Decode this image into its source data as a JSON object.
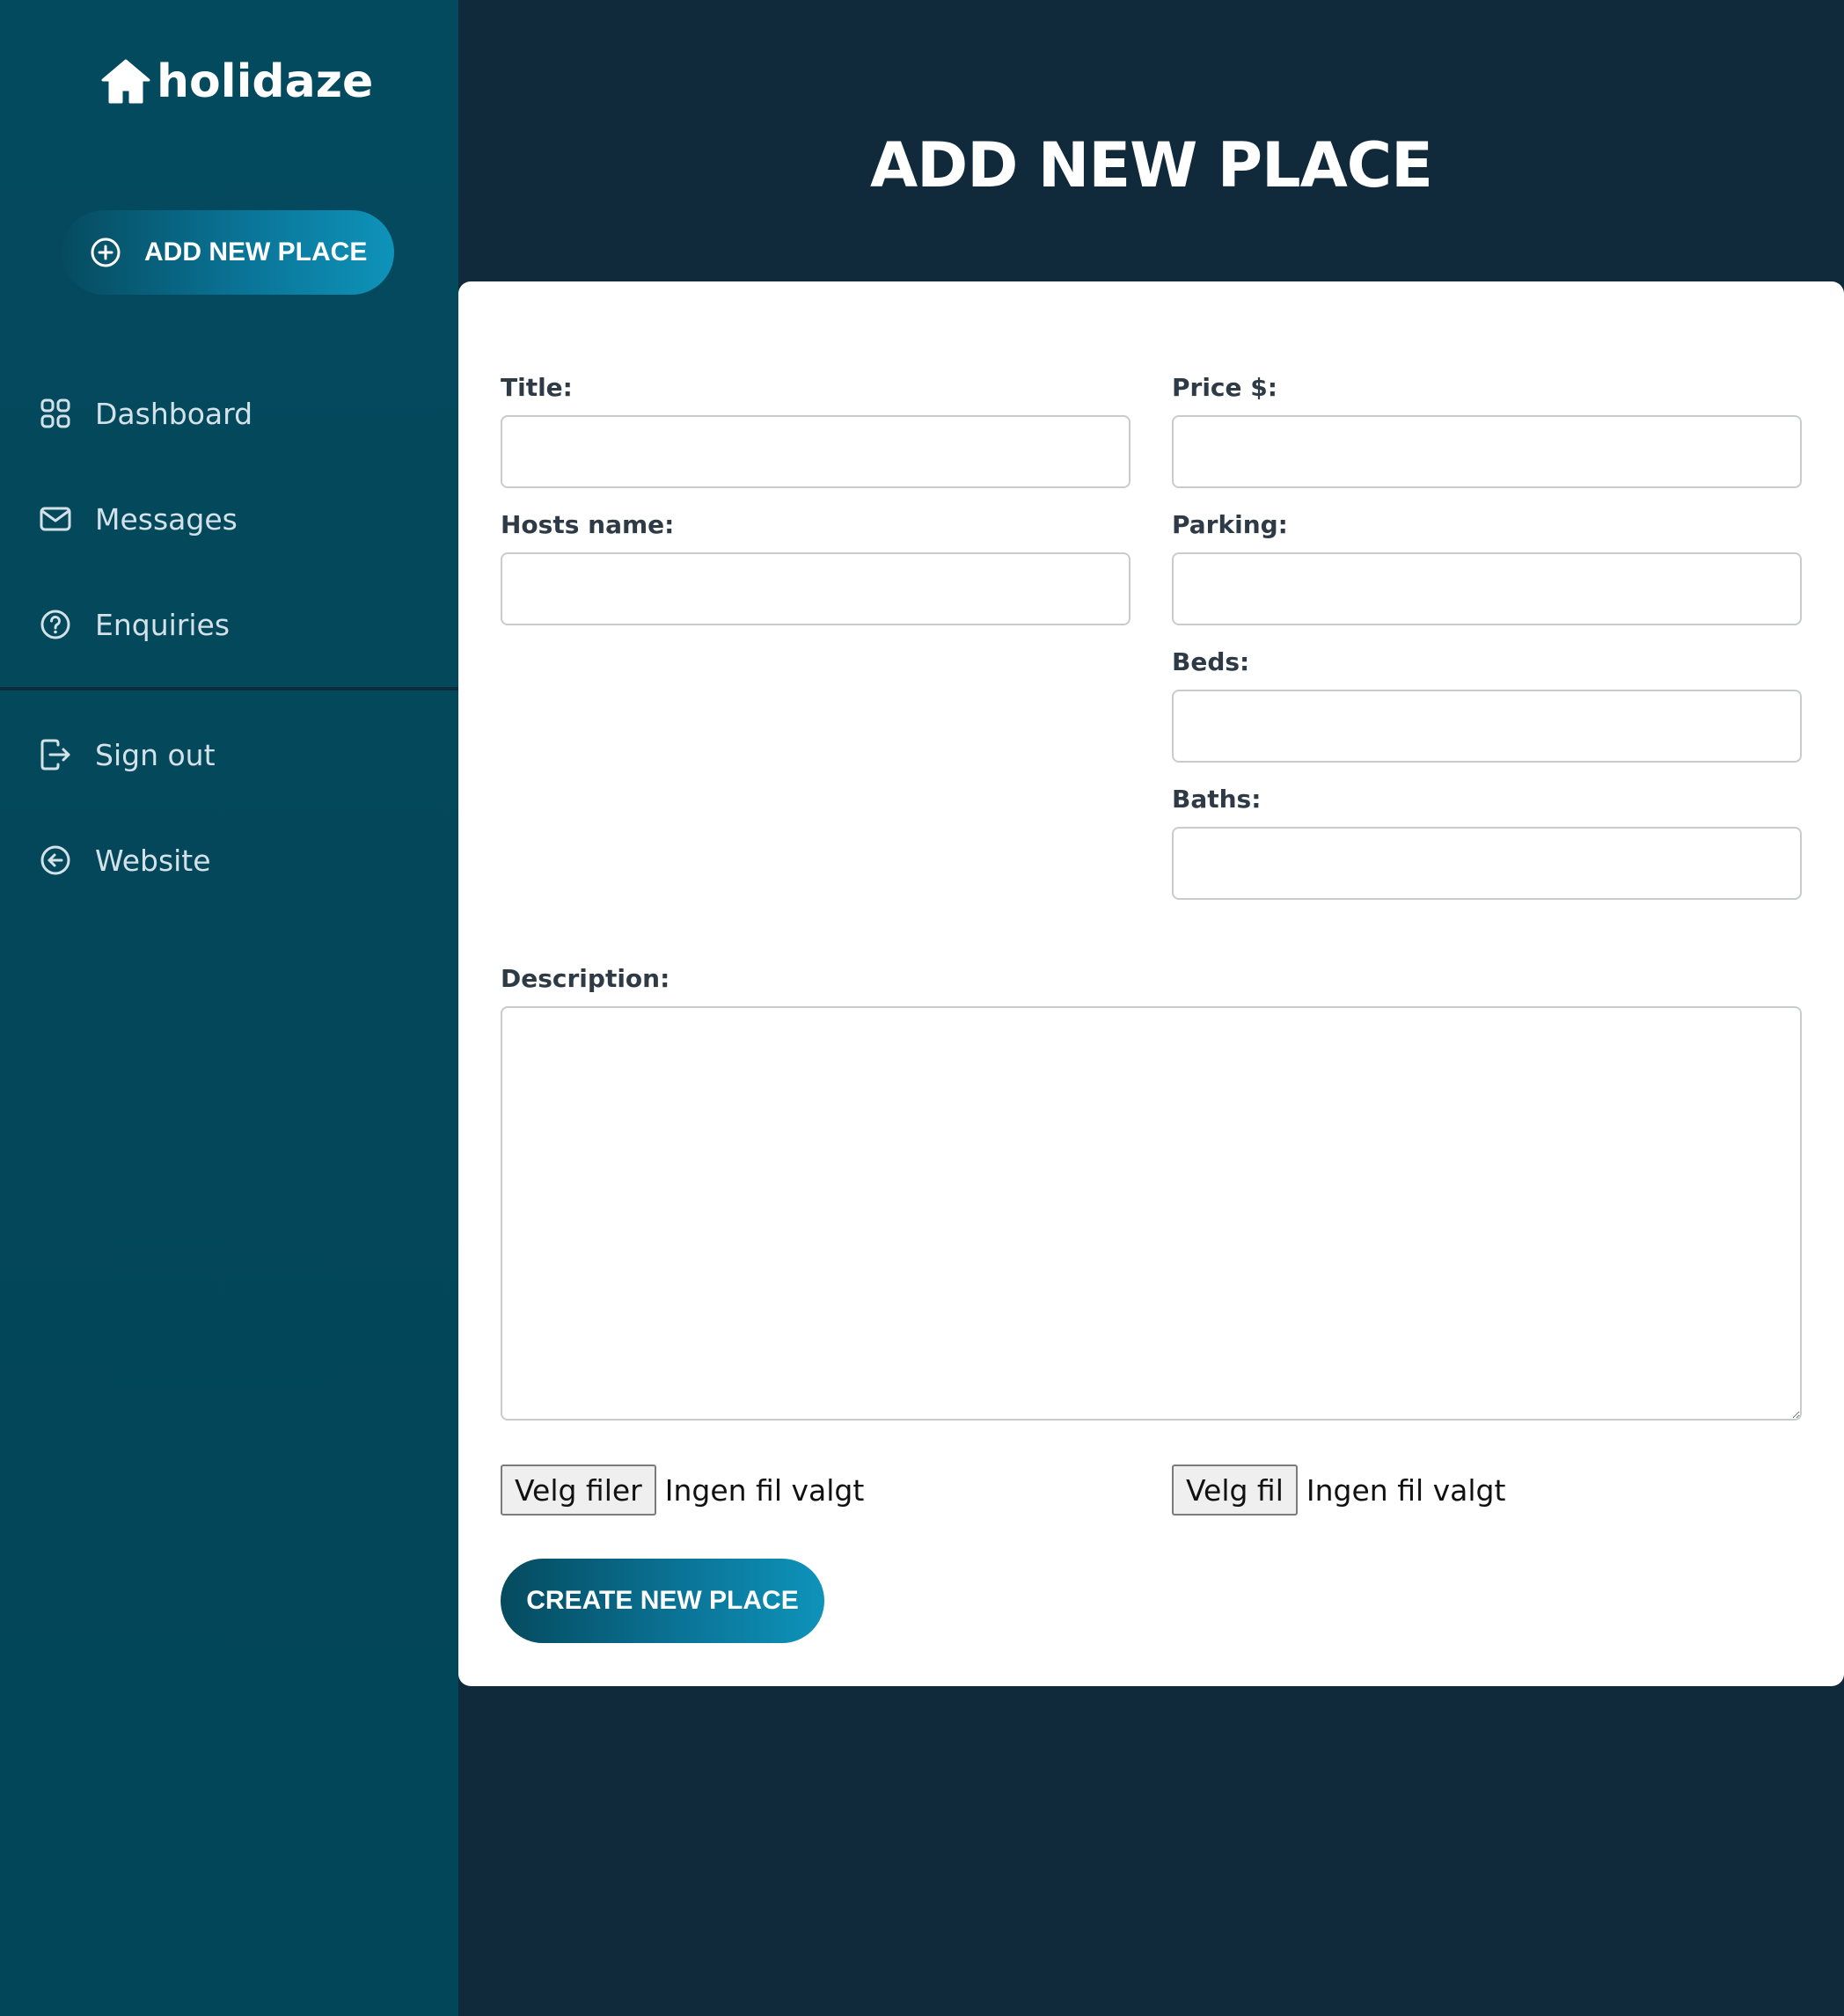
{
  "sidebar": {
    "logo_text": "holidaze",
    "add_button_label": "ADD NEW PLACE",
    "nav": [
      {
        "label": "Dashboard",
        "icon": "grid-icon"
      },
      {
        "label": "Messages",
        "icon": "mail-icon"
      },
      {
        "label": "Enquiries",
        "icon": "help-circle-icon"
      },
      {
        "label": "Sign out",
        "icon": "sign-out-icon"
      },
      {
        "label": "Website",
        "icon": "arrow-left-circle-icon"
      }
    ]
  },
  "main": {
    "title": "ADD NEW PLACE",
    "form": {
      "title_label": "Title:",
      "title_value": "",
      "hosts_label": "Hosts name:",
      "hosts_value": "",
      "price_label": "Price $:",
      "price_value": "",
      "parking_label": "Parking:",
      "parking_value": "",
      "beds_label": "Beds:",
      "beds_value": "",
      "baths_label": "Baths:",
      "baths_value": "",
      "description_label": "Description:",
      "description_value": "",
      "file_multi_button": "Velg filer",
      "file_multi_status": "Ingen fil valgt",
      "file_single_button": "Velg fil",
      "file_single_status": "Ingen fil valgt",
      "submit_label": "CREATE NEW PLACE"
    }
  },
  "colors": {
    "background": "#10293b",
    "sidebar": "#044a5e",
    "accent": "#0e93ba",
    "card": "#ffffff"
  }
}
